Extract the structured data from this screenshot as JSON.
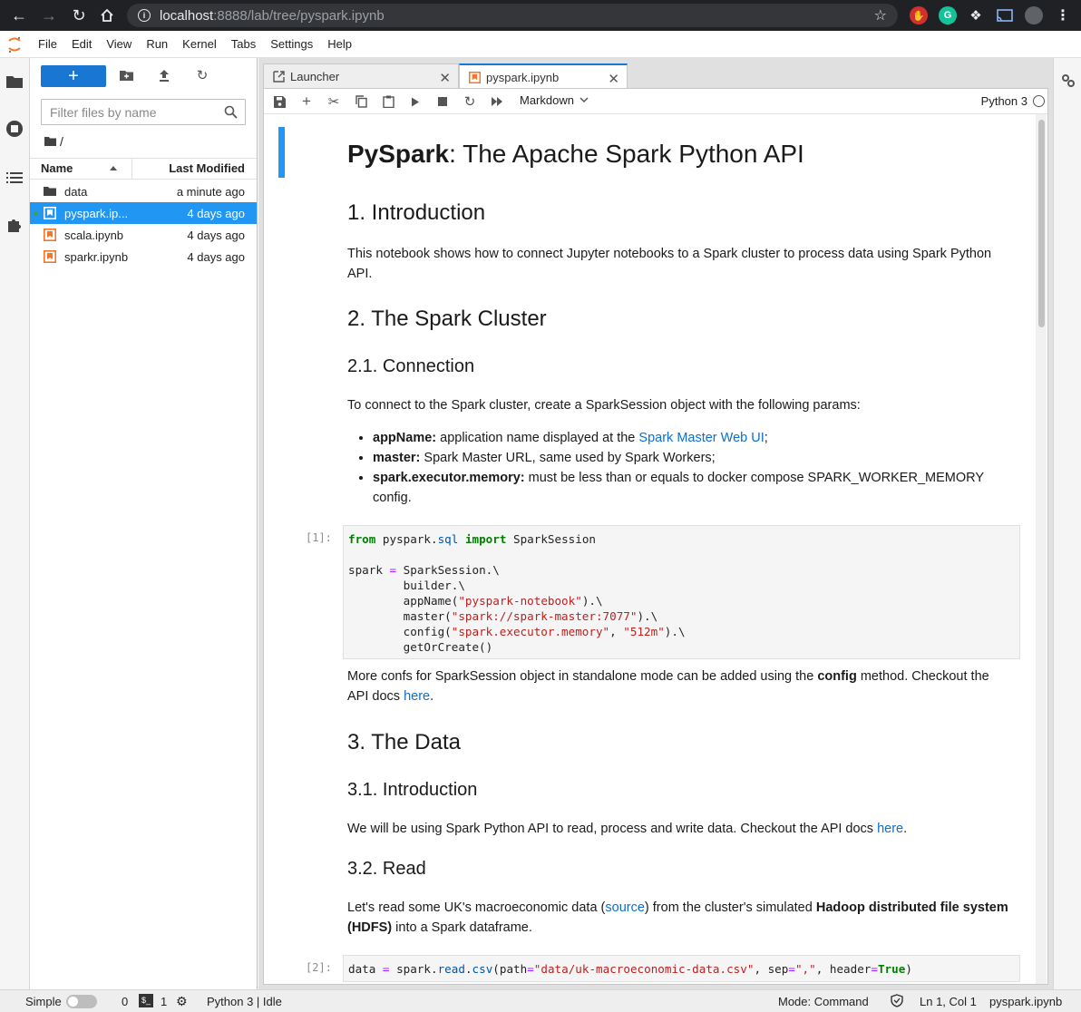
{
  "browser": {
    "url_host": "localhost",
    "url_rest": ":8888/lab/tree/pyspark.ipynb"
  },
  "menu": [
    "File",
    "Edit",
    "View",
    "Run",
    "Kernel",
    "Tabs",
    "Settings",
    "Help"
  ],
  "filebrowser": {
    "new_label": "+",
    "filter_placeholder": "Filter files by name",
    "breadcrumb": "/",
    "col_name": "Name",
    "col_modified": "Last Modified",
    "files": [
      {
        "name": "data",
        "modified": "a minute ago",
        "type": "folder"
      },
      {
        "name": "pyspark.ip...",
        "modified": "4 days ago",
        "type": "notebook",
        "selected": true
      },
      {
        "name": "scala.ipynb",
        "modified": "4 days ago",
        "type": "notebook"
      },
      {
        "name": "sparkr.ipynb",
        "modified": "4 days ago",
        "type": "notebook"
      }
    ]
  },
  "tabs": [
    {
      "label": "Launcher"
    },
    {
      "label": "pyspark.ipynb"
    }
  ],
  "notebook": {
    "cell_type": "Markdown",
    "kernel": "Python 3",
    "title_bold": "PySpark",
    "title_rest": ": The Apache Spark Python API",
    "h_intro": "1. Introduction",
    "p_intro": "This notebook shows how to connect Jupyter notebooks to a Spark cluster to process data using Spark Python API.",
    "h_cluster": "2. The Spark Cluster",
    "h_connection": "2.1. Connection",
    "p_connection": "To connect to the Spark cluster, create a SparkSession object with the following params:",
    "bullet1_bold": "appName:",
    "bullet1_text": " application name displayed at the ",
    "bullet1_link": "Spark Master Web UI",
    "bullet1_end": ";",
    "bullet2_bold": "master:",
    "bullet2_text": " Spark Master URL, same used by Spark Workers;",
    "bullet3_bold": "spark.executor.memory:",
    "bullet3_text": " must be less than or equals to docker compose SPARK_WORKER_MEMORY config.",
    "prompt1": "[1]:",
    "prompt2": "[2]:",
    "p_confs_a": "More confs for SparkSession object in standalone mode can be added using the ",
    "p_confs_bold": "config",
    "p_confs_b": " method. Checkout the API docs ",
    "p_confs_link": "here",
    "p_confs_end": ".",
    "h_data": "3. The Data",
    "h_data_intro": "3.1. Introduction",
    "p_data_intro": "We will be using Spark Python API to read, process and write data. Checkout the API docs ",
    "p_data_intro_link": "here",
    "p_data_intro_end": ".",
    "h_read": "3.2. Read",
    "p_read_a": "Let's read some UK's macroeconomic data (",
    "p_read_link": "source",
    "p_read_b": ") from the cluster's simulated ",
    "p_read_bold": "Hadoop distributed file system (HDFS)",
    "p_read_c": " into a Spark dataframe."
  },
  "status": {
    "mode_label": "Simple",
    "terminals": "0",
    "kernels": "1",
    "kernel_status": "Python 3 | Idle",
    "mode": "Mode: Command",
    "cursor": "Ln 1, Col 1",
    "file": "pyspark.ipynb"
  }
}
